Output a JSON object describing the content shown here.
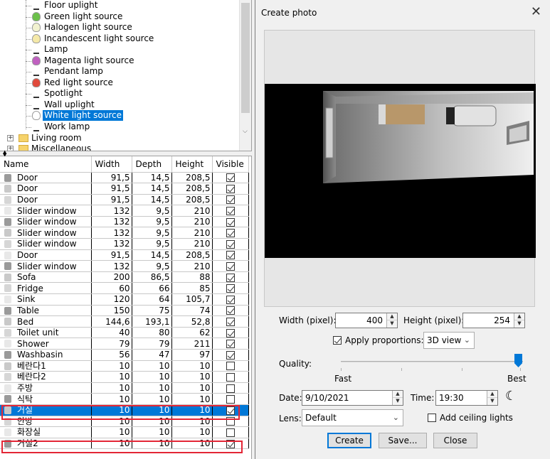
{
  "tree": {
    "items": [
      {
        "label": "Floor uplight",
        "icon": "floor-uplight-icon"
      },
      {
        "label": "Green light source",
        "icon": "green-bulb-icon",
        "color": "#6cc04a"
      },
      {
        "label": "Halogen light source",
        "icon": "halogen-bulb-icon",
        "color": "#f2f2d0"
      },
      {
        "label": "Incandescent light source",
        "icon": "incandescent-bulb-icon",
        "color": "#f5e9a8"
      },
      {
        "label": "Lamp",
        "icon": "lamp-icon"
      },
      {
        "label": "Magenta light source",
        "icon": "magenta-bulb-icon",
        "color": "#c060c0"
      },
      {
        "label": "Pendant lamp",
        "icon": "pendant-lamp-icon"
      },
      {
        "label": "Red light source",
        "icon": "red-bulb-icon",
        "color": "#e04a3c"
      },
      {
        "label": "Spotlight",
        "icon": "spotlight-icon"
      },
      {
        "label": "Wall uplight",
        "icon": "wall-uplight-icon"
      },
      {
        "label": "White light source",
        "icon": "white-bulb-icon",
        "color": "#ffffff"
      },
      {
        "label": "Work lamp",
        "icon": "work-lamp-icon"
      }
    ],
    "categories": [
      {
        "label": "Living room"
      },
      {
        "label": "Miscellaneous"
      }
    ]
  },
  "furniture": {
    "columns": [
      "Name",
      "Width",
      "Depth",
      "Height",
      "Visible"
    ],
    "rows": [
      {
        "name": "Door",
        "width": "91,5",
        "depth": "14,5",
        "height": "208,5",
        "visible": true
      },
      {
        "name": "Door",
        "width": "91,5",
        "depth": "14,5",
        "height": "208,5",
        "visible": true
      },
      {
        "name": "Door",
        "width": "91,5",
        "depth": "14,5",
        "height": "208,5",
        "visible": true
      },
      {
        "name": "Slider window",
        "width": "132",
        "depth": "9,5",
        "height": "210",
        "visible": true
      },
      {
        "name": "Slider window",
        "width": "132",
        "depth": "9,5",
        "height": "210",
        "visible": true
      },
      {
        "name": "Slider window",
        "width": "132",
        "depth": "9,5",
        "height": "210",
        "visible": true
      },
      {
        "name": "Slider window",
        "width": "132",
        "depth": "9,5",
        "height": "210",
        "visible": true
      },
      {
        "name": "Door",
        "width": "91,5",
        "depth": "14,5",
        "height": "208,5",
        "visible": true
      },
      {
        "name": "Slider window",
        "width": "132",
        "depth": "9,5",
        "height": "210",
        "visible": true
      },
      {
        "name": "Sofa",
        "width": "200",
        "depth": "86,5",
        "height": "88",
        "visible": true
      },
      {
        "name": "Fridge",
        "width": "60",
        "depth": "66",
        "height": "85",
        "visible": true
      },
      {
        "name": "Sink",
        "width": "120",
        "depth": "64",
        "height": "105,7",
        "visible": true
      },
      {
        "name": "Table",
        "width": "150",
        "depth": "75",
        "height": "74",
        "visible": true
      },
      {
        "name": "Bed",
        "width": "144,6",
        "depth": "193,1",
        "height": "52,8",
        "visible": true
      },
      {
        "name": "Toilet unit",
        "width": "40",
        "depth": "80",
        "height": "62",
        "visible": true
      },
      {
        "name": "Shower",
        "width": "79",
        "depth": "79",
        "height": "211",
        "visible": true
      },
      {
        "name": "Washbasin",
        "width": "56",
        "depth": "47",
        "height": "97",
        "visible": true
      },
      {
        "name": "베란다1",
        "width": "10",
        "depth": "10",
        "height": "10",
        "visible": false
      },
      {
        "name": "베란다2",
        "width": "10",
        "depth": "10",
        "height": "10",
        "visible": false
      },
      {
        "name": "주방",
        "width": "10",
        "depth": "10",
        "height": "10",
        "visible": false
      },
      {
        "name": "식탁",
        "width": "10",
        "depth": "10",
        "height": "10",
        "visible": false
      },
      {
        "name": "거실",
        "width": "10",
        "depth": "10",
        "height": "10",
        "visible": true,
        "selected": true
      },
      {
        "name": "안방",
        "width": "10",
        "depth": "10",
        "height": "10",
        "visible": false
      },
      {
        "name": "화장실",
        "width": "10",
        "depth": "10",
        "height": "10",
        "visible": false
      },
      {
        "name": "거실2",
        "width": "10",
        "depth": "10",
        "height": "10",
        "visible": true
      }
    ]
  },
  "dialog": {
    "title": "Create photo",
    "width_label": "Width (pixel):",
    "width_value": "400",
    "height_label": "Height (pixel):",
    "height_value": "254",
    "apply_proportions_label": "Apply proportions:",
    "apply_proportions_checked": true,
    "proportions_value": "3D view",
    "quality_label": "Quality:",
    "quality_fast": "Fast",
    "quality_best": "Best",
    "quality_level": 1.0,
    "date_label": "Date:",
    "date_value": "9/10/2021",
    "time_label": "Time:",
    "time_value": "19:30",
    "lens_label": "Lens:",
    "lens_value": "Default",
    "add_ceiling_lights_label": "Add ceiling lights",
    "add_ceiling_lights_checked": false,
    "create_label": "Create",
    "save_label": "Save...",
    "close_label": "Close"
  },
  "colors": {
    "selection": "#0078d7",
    "highlight_box": "#e32636"
  }
}
